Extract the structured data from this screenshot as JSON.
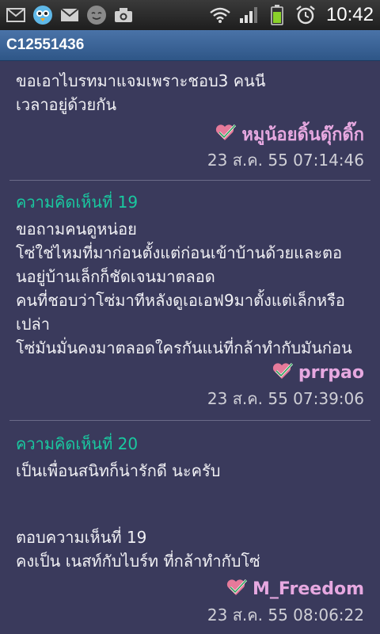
{
  "status": {
    "time": "10:42",
    "left_icons": [
      "mail-icon",
      "twitter-bird-icon",
      "gmail-icon",
      "smiley-icon",
      "camera-icon"
    ],
    "right_icons": [
      "wifi-icon",
      "signal-icon",
      "battery-icon",
      "alarm-icon"
    ]
  },
  "title": "C12551436",
  "colors": {
    "background": "#3a3a5c",
    "heading": "#19c9a0",
    "author": "#e6a8e0",
    "titlebar": "#3c6598"
  },
  "comments": [
    {
      "lines": [
        "ขอเอาไบรทมาแจมเพราะชอบ3 คนนี",
        "เวลาอยู่ด้วยกัน"
      ],
      "author": "หมูน้อยดิ้นดุ๊กดิ๊ก",
      "date": "23 ส.ค. 55 07:14:46"
    },
    {
      "heading": "ความคิดเห็นที่ 19",
      "lines": [
        "ขอถามคนดูหน่อย",
        "โซ่ใช่ไหมที่มาก่อนตั้งแต่ก่อนเข้าบ้านด้วยและตอ",
        "นอยู่บ้านเล็กก็ชัดเจนมาตลอด",
        "คนที่ชอบว่าโซ่มาทีหลังดูเอเอฟ9มาตั้งแต่เล็กหรือ",
        "เปล่า",
        "โซ่มันมั่นคงมาตลอดใครกันแน่ที่กล้าทำกับมันก่อน"
      ],
      "author": "prrpao",
      "date": "23 ส.ค. 55 07:39:06"
    },
    {
      "heading": "ความคิดเห็นที่ 20",
      "lines": [
        "เป็นเพื่อนสนิทก็น่ารักดี นะครับ"
      ],
      "quote_lines": [
        "ตอบความเห็นที่ 19",
        "คงเป็น เนสท์กับไบร์ท ที่กล้าทำกับโซ่"
      ],
      "author": "M_Freedom",
      "date": "23 ส.ค. 55 08:06:22"
    }
  ]
}
